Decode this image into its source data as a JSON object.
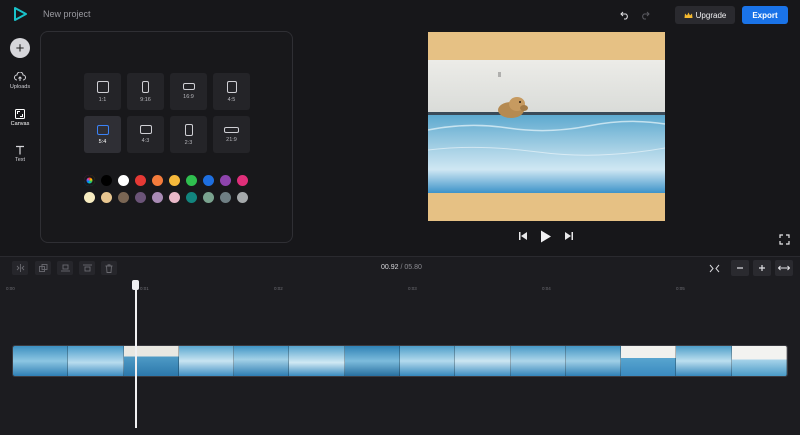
{
  "header": {
    "project_title": "New project",
    "upgrade_label": "Upgrade",
    "export_label": "Export"
  },
  "rail": {
    "items": [
      {
        "label": "Uploads",
        "icon": "upload-icon"
      },
      {
        "label": "Canvas",
        "icon": "canvas-icon"
      },
      {
        "label": "Text",
        "icon": "text-icon"
      }
    ]
  },
  "canvas": {
    "ratios": [
      {
        "label": "1:1",
        "w": 1,
        "h": 1
      },
      {
        "label": "9:16",
        "w": 9,
        "h": 16
      },
      {
        "label": "16:9",
        "w": 16,
        "h": 9
      },
      {
        "label": "4:5",
        "w": 4,
        "h": 5
      },
      {
        "label": "5:4",
        "w": 5,
        "h": 4,
        "active": true
      },
      {
        "label": "4:3",
        "w": 4,
        "h": 3
      },
      {
        "label": "2:3",
        "w": 2,
        "h": 3
      },
      {
        "label": "21:9",
        "w": 21,
        "h": 9
      }
    ],
    "colors": [
      "rainbow",
      "#000000",
      "#ffffff",
      "#e53935",
      "#f47c3c",
      "#f6b93b",
      "#2fbf4f",
      "#1e6fe0",
      "#8e44ad",
      "#e02f7a",
      "#f7ecc1",
      "#e8c690",
      "#7a6654",
      "#6b5478",
      "#a98bb5",
      "#e9b8c8",
      "#12857e",
      "#7aa38f",
      "#6f7f84",
      "#a5a9ab"
    ],
    "background_color": "#e6c184"
  },
  "timeline": {
    "current_time": "00.92",
    "total_time": "05.80",
    "ticks": [
      "0:00",
      "0:01",
      "0:02",
      "0:03",
      "0:04",
      "0:05"
    ]
  }
}
